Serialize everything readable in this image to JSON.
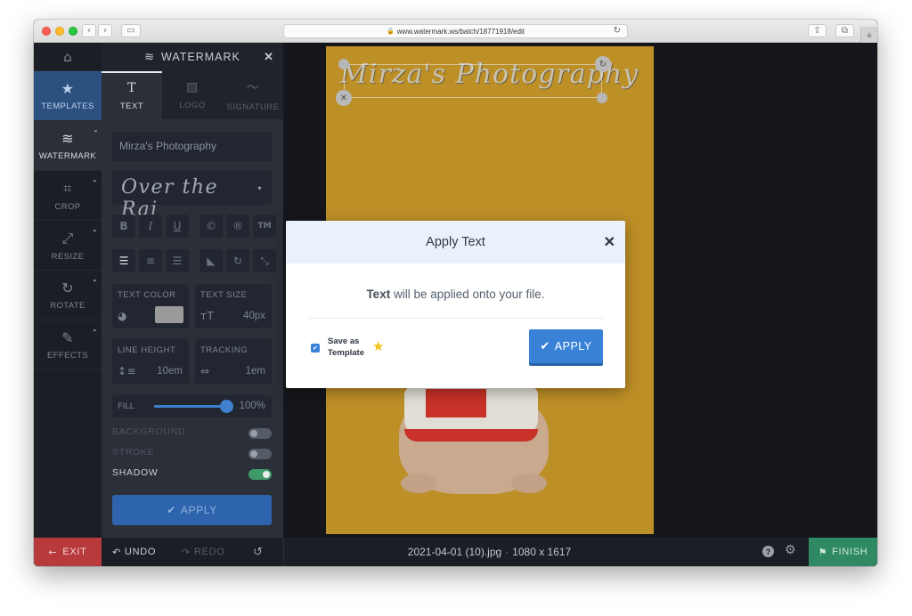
{
  "browser": {
    "url": "www.watermark.ws/batch/18771918/edit"
  },
  "sidebar": {
    "items": [
      {
        "label": "TEMPLATES",
        "icon": "star-icon"
      },
      {
        "label": "WATERMARK",
        "icon": "layers-icon"
      },
      {
        "label": "CROP",
        "icon": "crop-icon"
      },
      {
        "label": "RESIZE",
        "icon": "resize-icon"
      },
      {
        "label": "ROTATE",
        "icon": "rotate-icon"
      },
      {
        "label": "EFFECTS",
        "icon": "magic-wand-icon"
      }
    ]
  },
  "panel": {
    "title": "WATERMARK",
    "tabs": [
      {
        "label": "TEXT",
        "icon_glyph": "T"
      },
      {
        "label": "LOGO",
        "icon_glyph": "▨"
      },
      {
        "label": "SIGNATURE",
        "icon_glyph": "〜"
      }
    ],
    "text_value": "Mirza's Photography",
    "font_preview": "Over the Rai",
    "format_buttons": [
      "B",
      "I",
      "U",
      "©",
      "®",
      "TM"
    ],
    "text_color_label": "TEXT COLOR",
    "text_size_label": "TEXT SIZE",
    "text_size_value": "40px",
    "line_height_label": "LINE HEIGHT",
    "line_height_value": "10em",
    "tracking_label": "TRACKING",
    "tracking_value": "1em",
    "fill_label": "FILL",
    "fill_value": "100%",
    "fill_fraction": 1.0,
    "background_label": "BACKGROUND",
    "stroke_label": "STROKE",
    "shadow_label": "SHADOW",
    "apply_label": "APPLY"
  },
  "canvas": {
    "watermark_text": "Mirza's Photography"
  },
  "modal": {
    "title": "Apply Text",
    "message_bold": "Text",
    "message_rest": " will be applied onto your file.",
    "save_line1": "Save as",
    "save_line2": "Template",
    "apply_label": "APPLY"
  },
  "bottom": {
    "exit_label": "EXIT",
    "undo_label": "UNDO",
    "redo_label": "REDO",
    "file_name": "2021-04-01 (10).jpg",
    "file_sep": "·",
    "file_dims": "1080 x 1617",
    "finish_label": "FINISH"
  },
  "colors": {
    "accent_blue": "#3a82d8",
    "exit_red": "#b83a3c",
    "finish_green": "#2f8a63",
    "photo_background": "#cc9a2b"
  }
}
